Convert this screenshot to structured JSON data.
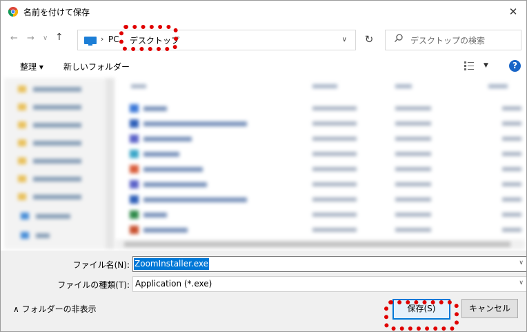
{
  "window": {
    "title": "名前を付けて保存",
    "close": "✕"
  },
  "address": {
    "sep": "›",
    "crumbs": [
      "PC",
      "デスクトップ"
    ],
    "search_placeholder": "デスクトップの検索"
  },
  "toolbar": {
    "organize": "整理 ▾",
    "new_folder": "新しいフォルダー"
  },
  "form": {
    "file_name_label": "ファイル名(N):",
    "file_name_value": "ZoomInstaller.exe",
    "file_type_label": "ファイルの種類(T):",
    "file_type_value": "Application (*.exe)"
  },
  "footer": {
    "hide_folders": "∧ フォルダーの非表示",
    "save": "保存(S)",
    "cancel": "キャンセル"
  },
  "colors": {
    "highlight": "#e00000",
    "accent": "#0078d7",
    "help": "#1865c7"
  }
}
